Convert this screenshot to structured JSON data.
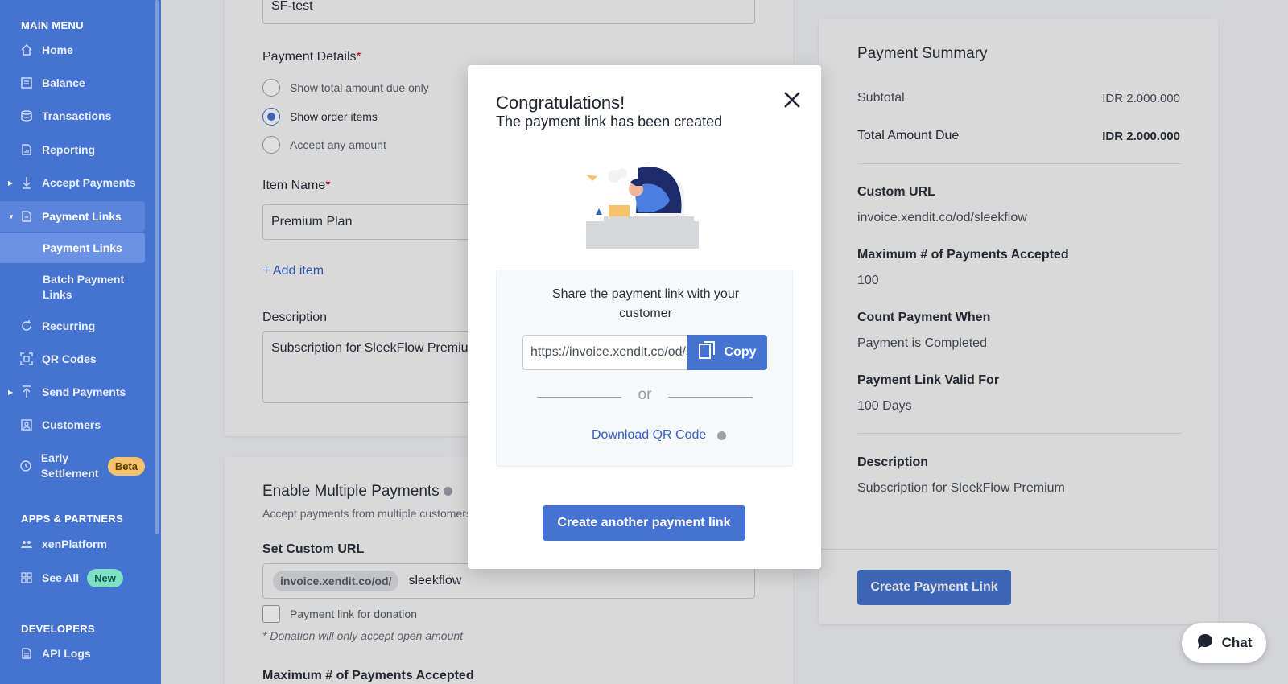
{
  "sidebar": {
    "main_menu_title": "MAIN MENU",
    "items": [
      {
        "label": "Home",
        "icon": "home-icon"
      },
      {
        "label": "Balance",
        "icon": "balance-icon"
      },
      {
        "label": "Transactions",
        "icon": "transactions-icon"
      },
      {
        "label": "Reporting",
        "icon": "reporting-icon"
      },
      {
        "label": "Accept Payments",
        "icon": "accept-payments-icon"
      },
      {
        "label": "Payment Links",
        "icon": "payment-links-icon"
      },
      {
        "label": "Recurring",
        "icon": "recurring-icon"
      },
      {
        "label": "QR Codes",
        "icon": "qr-code-icon"
      },
      {
        "label": "Send Payments",
        "icon": "send-payments-icon"
      },
      {
        "label": "Customers",
        "icon": "customers-icon"
      },
      {
        "label": "Early Settlement",
        "icon": "early-settlement-icon",
        "badge": "Beta"
      }
    ],
    "sub_items": [
      "Payment Links",
      "Batch Payment Links"
    ],
    "apps_title": "APPS & PARTNERS",
    "apps_items": [
      {
        "label": "xenPlatform",
        "icon": "xenplatform-icon"
      },
      {
        "label": "See All",
        "icon": "grid-icon",
        "badge": "New"
      }
    ],
    "developers_title": "DEVELOPERS",
    "developers_items": [
      {
        "label": "API Logs",
        "icon": "api-logs-icon"
      }
    ]
  },
  "form": {
    "reference_value": "SF-test",
    "payment_details_label": "Payment Details",
    "payment_options": [
      "Show total amount due only",
      "Show order items",
      "Accept any amount"
    ],
    "selected_option": "Show order items",
    "item_name_label": "Item Name",
    "item_name_value": "Premium Plan",
    "add_item": "+ Add item",
    "description_label": "Description",
    "description_value": "Subscription for SleekFlow Premium",
    "multi_title": "Enable Multiple Payments",
    "multi_subtitle": "Accept payments from multiple customers",
    "custom_url_label": "Set Custom URL",
    "custom_url_prefix": "invoice.xendit.co/od/",
    "custom_url_value": "sleekflow",
    "donation_label": "Payment link for donation",
    "donation_note": "* Donation will only accept open amount",
    "max_payments_label": "Maximum # of Payments Accepted"
  },
  "summary": {
    "title": "Payment Summary",
    "subtotal_label": "Subtotal",
    "subtotal_value": "IDR 2.000.000",
    "total_label": "Total Amount Due",
    "total_value": "IDR 2.000.000",
    "custom_url_label": "Custom URL",
    "custom_url_value": "invoice.xendit.co/od/sleekflow",
    "max_label": "Maximum # of Payments Accepted",
    "max_value": "100",
    "count_label": "Count Payment When",
    "count_value": "Payment is Completed",
    "valid_label": "Payment Link Valid For",
    "valid_value": "100 Days",
    "desc_label": "Description",
    "desc_value": "Subscription for SleekFlow Premium",
    "create_button": "Create Payment Link"
  },
  "modal": {
    "title": "Congratulations!",
    "subtitle": "The payment link has been created",
    "share_text": "Share the payment link with your customer",
    "link_value": "https://invoice.xendit.co/od/sleekflow",
    "copy_label": "Copy",
    "or_label": "or",
    "download_label": "Download QR Code",
    "create_another": "Create another payment link"
  },
  "chat": {
    "label": "Chat"
  },
  "colors": {
    "brand": "#4573d2",
    "sidebar_bg": "#4573d2",
    "beta_badge": "#f6c36a",
    "new_badge": "#7ee0c4"
  }
}
